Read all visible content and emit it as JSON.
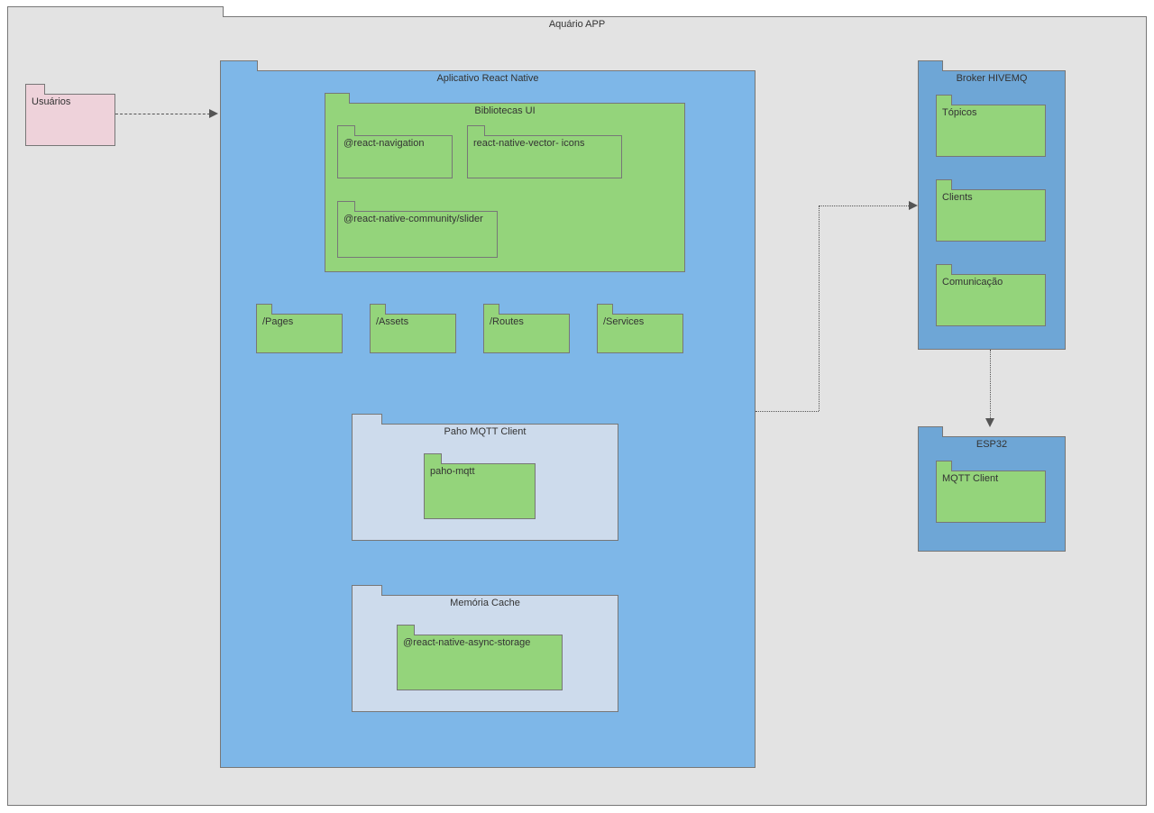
{
  "diagram": {
    "title": "Aquário APP",
    "users": "Usuários",
    "app": {
      "title": "Aplicativo React Native",
      "ui_libs": {
        "title": "Bibliotecas UI",
        "items": [
          "@react-navigation",
          "react-native-vector- icons",
          "@react-native-community/slider"
        ]
      },
      "folders": [
        "/Pages",
        "/Assets",
        "/Routes",
        "/Services"
      ],
      "paho": {
        "title": "Paho MQTT Client",
        "item": "paho-mqtt"
      },
      "cache": {
        "title": "Memória Cache",
        "item": "@react-native-async-storage"
      }
    },
    "broker": {
      "title": "Broker HIVEMQ",
      "items": [
        "Tópicos",
        "Clients",
        "Comunicação"
      ]
    },
    "esp32": {
      "title": "ESP32",
      "item": "MQTT Client"
    }
  },
  "colors": {
    "page": "#e3e3e3",
    "pink": "#eed2da",
    "blue": "#7eb7e8",
    "blue_d": "#6ea6d6",
    "lblue": "#cddbec",
    "green": "#94d47b"
  }
}
